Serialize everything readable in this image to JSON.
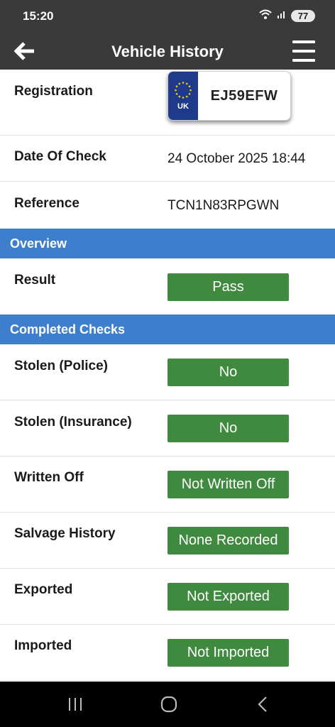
{
  "status": {
    "time": "15:20",
    "battery": "77",
    "wifi_icon": "wifi-icon",
    "signal_icon": "signal-icon"
  },
  "header": {
    "title": "Vehicle History",
    "back_icon": "arrow-left-icon",
    "menu_icon": "hamburger-menu-icon"
  },
  "details": {
    "registration_label": "Registration",
    "plate_country": "UK",
    "plate_reg": "EJ59EFW",
    "date_label": "Date Of Check",
    "date_value": "24 October 2025 18:44",
    "reference_label": "Reference",
    "reference_value": "TCN1N83RPGWN"
  },
  "overview": {
    "title": "Overview",
    "result_label": "Result",
    "result_value": "Pass"
  },
  "checks": {
    "title": "Completed Checks",
    "items": [
      {
        "label": "Stolen (Police)",
        "value": "No"
      },
      {
        "label": "Stolen (Insurance)",
        "value": "No"
      },
      {
        "label": "Written Off",
        "value": "Not Written Off"
      },
      {
        "label": "Salvage History",
        "value": "None Recorded"
      },
      {
        "label": "Exported",
        "value": "Not Exported"
      },
      {
        "label": "Imported",
        "value": "Not Imported"
      }
    ]
  },
  "colors": {
    "header_bg": "#3a3a3a",
    "section_blue": "#3d7fcc",
    "pass_green": "#3f8a3f",
    "plate_blue": "#1f3a8a"
  },
  "nav": {
    "recent_icon": "recent-apps-icon",
    "home_icon": "home-icon",
    "back_icon": "nav-back-icon"
  }
}
